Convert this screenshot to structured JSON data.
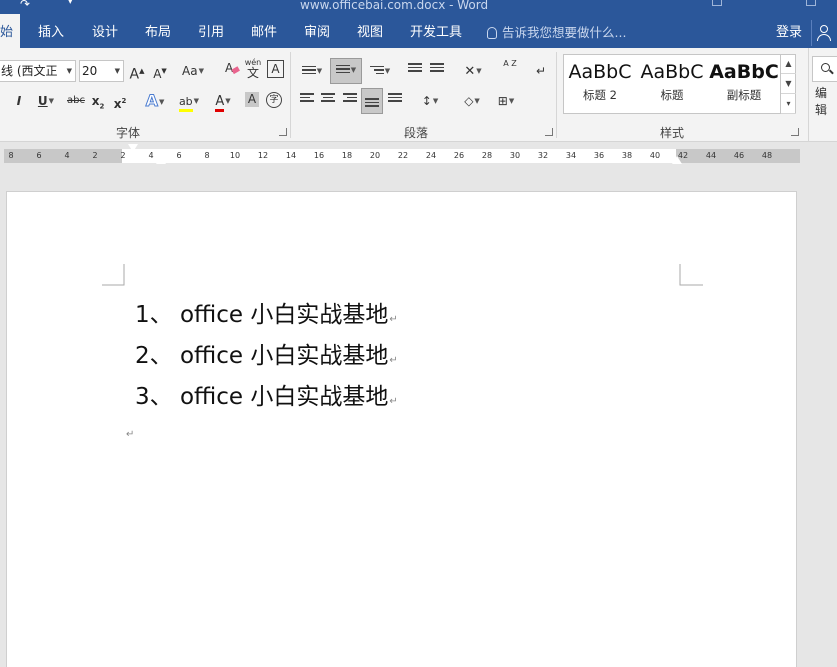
{
  "window": {
    "title": "www.officebai.com.docx - Word"
  },
  "tabs": [
    {
      "label": "始",
      "active": true
    },
    {
      "label": "插入"
    },
    {
      "label": "设计"
    },
    {
      "label": "布局"
    },
    {
      "label": "引用"
    },
    {
      "label": "邮件"
    },
    {
      "label": "审阅"
    },
    {
      "label": "视图"
    },
    {
      "label": "开发工具"
    }
  ],
  "tell_me": "告诉我您想要做什么...",
  "account": {
    "login": "登录"
  },
  "font_group": {
    "label": "字体",
    "font_name": "线 (西文正",
    "font_size": "20",
    "grow_label": "A",
    "shrink_label": "A",
    "case_label": "Aa",
    "phonetic_label": "wén",
    "phonetic_char": "文",
    "border_char": "A",
    "italic": "I",
    "underline": "U",
    "strike": "abc",
    "subscript": "x",
    "subscript_mark": "2",
    "superscript": "x",
    "superscript_mark": "2",
    "effects": "A",
    "highlight": "ab",
    "font_color": "A",
    "shading_char": "A",
    "enclose_char": "字"
  },
  "paragraph_group": {
    "label": "段落",
    "sort_label": "A Z"
  },
  "styles_group": {
    "label": "样式",
    "items": [
      {
        "sample": "AaBbC",
        "name": "标题 2"
      },
      {
        "sample": "AaBbC",
        "name": "标题"
      },
      {
        "sample": "AaBbC",
        "name": "副标题"
      }
    ]
  },
  "editing": {
    "label": "编辑"
  },
  "ruler": {
    "ticks": [
      "8",
      "6",
      "4",
      "2",
      "2",
      "4",
      "6",
      "8",
      "10",
      "12",
      "14",
      "16",
      "18",
      "20",
      "22",
      "24",
      "26",
      "28",
      "30",
      "32",
      "34",
      "36",
      "38",
      "40",
      "42",
      "44",
      "46",
      "48"
    ]
  },
  "document": {
    "items": [
      {
        "number": "1、",
        "text": "office 小白实战基地"
      },
      {
        "number": "2、",
        "text": "office 小白实战基地"
      },
      {
        "number": "3、",
        "text": "office 小白实战基地"
      }
    ],
    "paragraph_mark": "↵"
  },
  "colors": {
    "brand": "#2b579a",
    "highlight": "#ffff00",
    "font_color": "#e00000"
  }
}
